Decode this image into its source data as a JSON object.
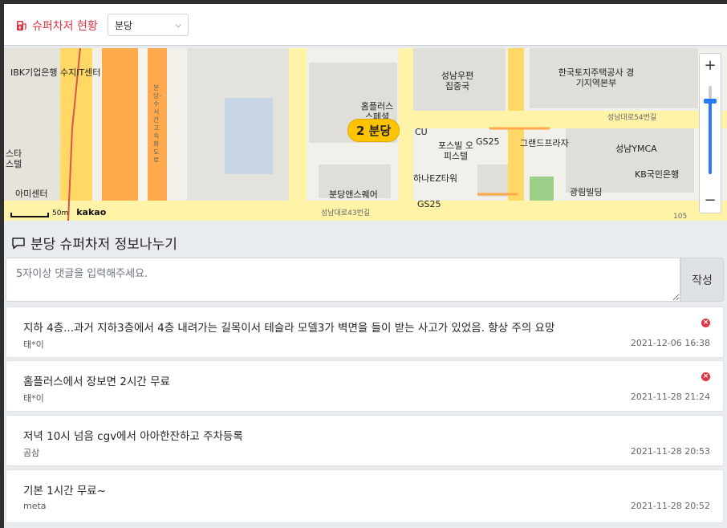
{
  "header": {
    "title": "슈퍼차저 현황",
    "selected_location": "분당"
  },
  "map": {
    "marker_label": "2 분당",
    "brand": "kakao",
    "scale_label": "50m",
    "zoom_in": "+",
    "zoom_out": "−",
    "labels": [
      "IBK기업은행 수지IT센터",
      "스타 스텔",
      "아미센터",
      "홈플러스 스페셜",
      "성남우편 집중국",
      "한국토지주택공사 경기지역본부",
      "CU",
      "GS25",
      "그랜드프라자",
      "포스빌 오피스텔",
      "성남YMCA",
      "KB국민은행",
      "하나EZ타워",
      "광림빌딩",
      "분당앤스퀘어",
      "GS25",
      "성남대로43번길",
      "성남대로54번길",
      "분당-수서간고속화도로",
      "105"
    ]
  },
  "board": {
    "title": "분당 슈퍼차저 정보나누기",
    "input_placeholder": "5자이상 댓글을 입력해주세요.",
    "submit_label": "작성",
    "comments": [
      {
        "text": "지하 4층...과거 지하3층에서 4층 내려가는 길목이서 테슬라 모델3가 벽면을 들이 받는 사고가 있었음. 항상 주의 요망",
        "author": "태*이",
        "date": "2021-12-06 16:38",
        "deletable": true
      },
      {
        "text": "홈플러스에서 장보면 2시간 무료",
        "author": "태*이",
        "date": "2021-11-28 21:24",
        "deletable": true
      },
      {
        "text": "저녁 10시 넘음 cgv에서 아아한잔하고 주차등록",
        "author": "곰삼",
        "date": "2021-11-28 20:53",
        "deletable": false
      },
      {
        "text": "기본 1시간 무료~",
        "author": "meta",
        "date": "2021-11-28 20:52",
        "deletable": false
      }
    ]
  },
  "colors": {
    "accent": "#dc3545",
    "map_road": "#ffa94d",
    "marker": "#ffc400",
    "zoom": "#2979ff"
  }
}
